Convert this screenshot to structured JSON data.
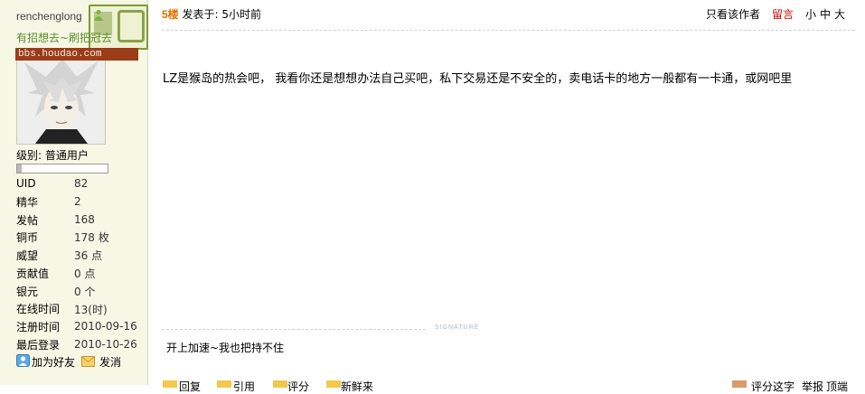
{
  "sidebar": {
    "username": "renchenglong",
    "user_title": "有招想去~刷把冠去",
    "site_watermark": "bbs.houdao.com",
    "level": {
      "label": "级别:",
      "value": "普通用户",
      "progress": 0.05
    },
    "stats": [
      {
        "label": "UID",
        "value": "82"
      },
      {
        "label": "精华",
        "value": "2"
      },
      {
        "label": "发帖",
        "value": "168"
      },
      {
        "label": "铜币",
        "value": "178 枚"
      },
      {
        "label": "威望",
        "value": "36 点"
      },
      {
        "label": "贡献值",
        "value": "0 点"
      },
      {
        "label": "银元",
        "value": "0 个"
      },
      {
        "label": "在线时间",
        "value": "13(时)"
      },
      {
        "label": "注册时间",
        "value": "2010-09-16"
      },
      {
        "label": "最后登录",
        "value": "2010-10-26"
      }
    ],
    "actions": {
      "add_friend": "加为好友",
      "send_message": "发消"
    }
  },
  "post": {
    "floor": "5楼",
    "posted_at": "发表于: 5小时前",
    "only_author": "只看该作者",
    "comment": "留言",
    "font_small": "小",
    "font_medium": "中",
    "font_large": "大",
    "content": "LZ是猴岛的热会吧，  我看你还是想想办法自己买吧，私下交易还是不安全的，卖电话卡的地方一般都有一卡通，或网吧里",
    "signature_label": "SIGNATURE",
    "signature": "开上加速~我也把持不住"
  },
  "bottom_bar": {
    "reply": "回复",
    "quote": "引用",
    "rate": "评分",
    "new_post": "新鲜来",
    "rate_hint": "评分这字",
    "report": "举报",
    "top": "顶端"
  },
  "colors": {
    "floor": "#e07000",
    "comment": "#c40000",
    "sidebar_bg": "#f7f7e6"
  }
}
